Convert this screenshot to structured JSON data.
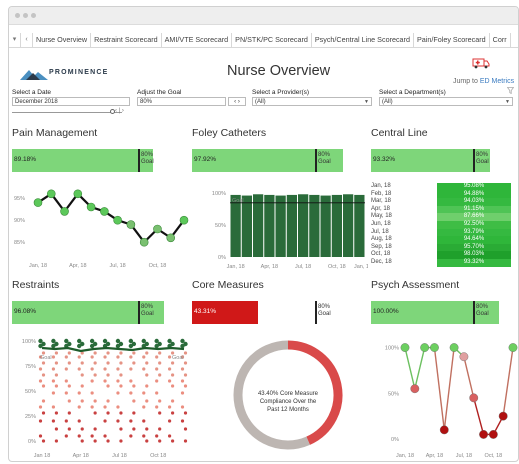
{
  "tabs": [
    "Nurse Overview",
    "Restraint Scorecard",
    "AMI/VTE Scorecard",
    "PN/STK/PC Scorecard",
    "Psych/Central Line Scorecard",
    "Pain/Foley Scorecard",
    "Corr"
  ],
  "logo": {
    "text": "PROMINENCE"
  },
  "page_title": "Nurse Overview",
  "jump": {
    "prefix": "Jump to ",
    "link": "ED Metrics"
  },
  "filters": {
    "date": {
      "label": "Select a Date",
      "value": "December 2018"
    },
    "goal": {
      "label": "Adjust the Goal",
      "value": "80%"
    },
    "provider": {
      "label": "Select a Provider(s)",
      "value": "(All)"
    },
    "department": {
      "label": "Select a Department(s)",
      "value": "(All)"
    }
  },
  "colors": {
    "green_bar": "#7ed67a",
    "green_dark": "#2a6b3a",
    "green_line": "#1e5c2b",
    "red_bar": "#d01818",
    "grey_ring": "#bdb6b2",
    "red_ring": "#d94a4a"
  },
  "panels": {
    "pain": {
      "title": "Pain Management",
      "value": "89.18%",
      "goal": "80%",
      "goal_word": "Goal",
      "fill": 0.89
    },
    "foley": {
      "title": "Foley Catheters",
      "value": "97.92%",
      "goal": "80%",
      "goal_word": "Goal",
      "fill": 0.98
    },
    "central": {
      "title": "Central Line",
      "value": "93.32%",
      "goal": "80%",
      "goal_word": "Goal",
      "fill": 0.93
    },
    "restraints": {
      "title": "Restraints",
      "value": "96.08%",
      "goal": "80%",
      "goal_word": "Goal",
      "fill": 0.96
    },
    "core": {
      "title": "Core Measures",
      "value": "43.31%",
      "goal": "80%",
      "goal_word": "Goal",
      "fill": 0.43
    },
    "psych": {
      "title": "Psych Assessment",
      "value": "100.00%",
      "goal": "80%",
      "goal_word": "Goal",
      "fill": 1.0
    }
  },
  "chart_data": [
    {
      "type": "line",
      "name": "pain",
      "x": [
        "Jan, 18",
        "Feb, 18",
        "Mar, 18",
        "Apr, 18",
        "May, 18",
        "Jun, 18",
        "Jul, 18",
        "Aug, 18",
        "Sep, 18",
        "Oct, 18",
        "Nov, 18",
        "Dec, 18"
      ],
      "values": [
        94,
        96,
        92,
        96,
        93,
        92,
        90,
        89,
        85,
        88,
        86,
        90
      ],
      "ylim": [
        83,
        98
      ],
      "yticks": [
        "95%",
        "90%",
        "85%"
      ],
      "xticks": [
        "Jan, 18",
        "Apr, 18",
        "Jul, 18",
        "Oct, 18"
      ]
    },
    {
      "type": "bar",
      "name": "foley",
      "x": [
        "Jan, 18",
        "Feb, 18",
        "Mar, 18",
        "Apr, 18",
        "May, 18",
        "Jun, 18",
        "Jul, 18",
        "Aug, 18",
        "Sep, 18",
        "Oct, 18",
        "Nov, 18",
        "Dec, 18"
      ],
      "values": [
        97,
        96,
        98,
        97,
        96,
        97,
        98,
        97,
        96,
        97,
        98,
        97
      ],
      "ylim": [
        0,
        100
      ],
      "yticks": [
        "100%",
        "50%",
        "0%"
      ],
      "xticks": [
        "Jan, 18",
        "Apr, 18",
        "Jul, 18",
        "Oct, 18",
        "Jan, 19"
      ],
      "goal_label": "Goal"
    },
    {
      "type": "table",
      "name": "central",
      "rows": [
        [
          "Jan, 18",
          "95.08%"
        ],
        [
          "Feb, 18",
          "94.88%"
        ],
        [
          "Mar, 18",
          "94.03%"
        ],
        [
          "Apr, 18",
          "91.15%"
        ],
        [
          "May, 18",
          "87.66%"
        ],
        [
          "Jun, 18",
          "92.50%"
        ],
        [
          "Jul, 18",
          "93.79%"
        ],
        [
          "Aug, 18",
          "94.64%"
        ],
        [
          "Sep, 18",
          "95.70%"
        ],
        [
          "Oct, 18",
          "98.03%"
        ],
        [
          "Dec, 18",
          "93.32%"
        ]
      ]
    },
    {
      "type": "scatter",
      "name": "restraints",
      "yticks": [
        "100%",
        "75%",
        "50%",
        "25%",
        "0%"
      ],
      "xticks": [
        "Jan 18",
        "Apr 18",
        "Jul 18",
        "Oct 18"
      ],
      "goal_label": "Goal",
      "series_line": [
        93,
        92,
        93,
        90,
        92,
        93,
        92,
        91,
        93,
        92,
        93,
        92
      ]
    },
    {
      "type": "pie",
      "name": "core",
      "values": [
        43.4,
        56.6
      ],
      "center_text": "43.40% Core Measure Compliance Over the Past 12 Months"
    },
    {
      "type": "line",
      "name": "psych",
      "x": [
        "Jan, 18",
        "Feb, 18",
        "Mar, 18",
        "Apr, 18",
        "May, 18",
        "Jun, 18",
        "Jul, 18",
        "Aug, 18",
        "Sep, 18",
        "Oct, 18",
        "Nov, 18",
        "Dec, 18"
      ],
      "values": [
        100,
        55,
        100,
        100,
        10,
        100,
        90,
        45,
        5,
        5,
        25,
        100
      ],
      "ylim": [
        0,
        105
      ],
      "yticks": [
        "100%",
        "50%",
        "0%"
      ],
      "xticks": [
        "Jan, 18",
        "Apr, 18",
        "Jul, 18",
        "Oct, 18"
      ]
    }
  ]
}
